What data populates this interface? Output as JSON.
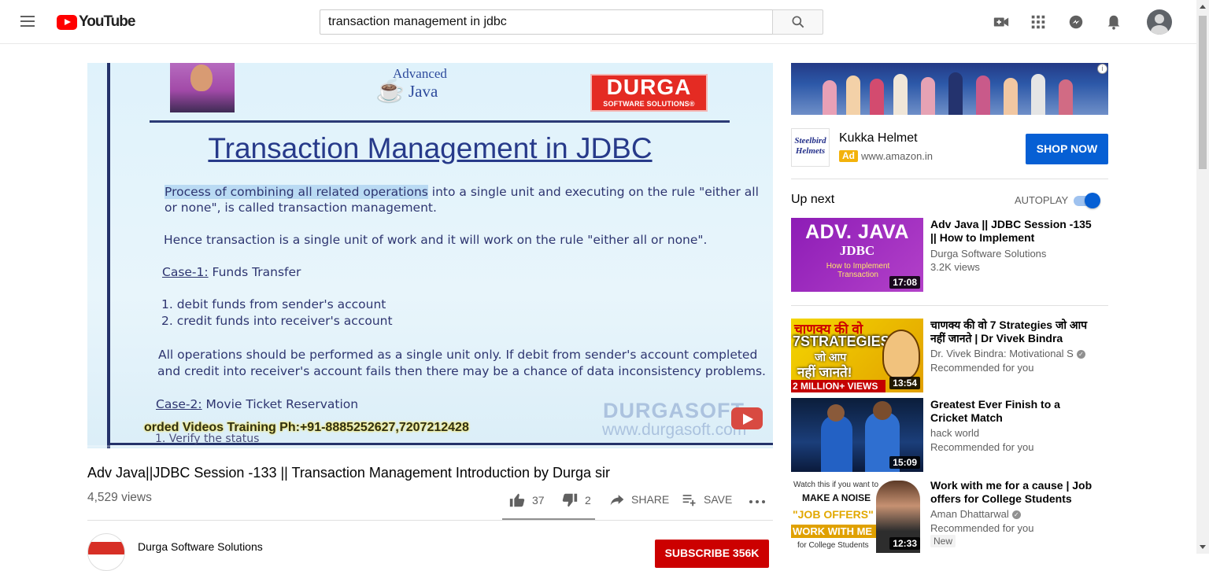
{
  "header": {
    "logo_text": "YouTube",
    "search_value": "transaction management in jdbc",
    "icons": [
      "menu-icon",
      "search-icon",
      "create-video-icon",
      "apps-icon",
      "messages-icon",
      "notifications-icon",
      "account-avatar"
    ]
  },
  "player": {
    "slide": {
      "logo_advanced": "Advanced",
      "logo_java": "Java",
      "brand_big": "DURGA",
      "brand_small": "SOFTWARE SOLUTIONS®",
      "title": "Transaction Management in JDBC",
      "line1_highlight": "Process of combining all related operations",
      "line1_rest": " into a single unit and executing on the rule \"either all",
      "line2": "or none\", is called transaction management.",
      "line3": "Hence transaction is a single unit of work and it will work on the rule \"either all or none\".",
      "case1_label": "Case-1:",
      "case1_text": " Funds Transfer",
      "item1": "1. debit funds from sender's account",
      "item2": "2. credit funds into receiver's account",
      "para1": "All operations should be performed as a single unit only. If debit from sender's account completed",
      "para2": "and credit into receiver's account fails then there may be a chance of data inconsistency problems.",
      "case2_label": "Case-2:",
      "case2_text": " Movie Ticket Reservation",
      "ticker": "orded Videos Training Ph:+91-8885252627,7207212428",
      "ticker_under": "1. Verify the status",
      "watermark1": "DURGASOFT",
      "watermark2": "www.durgasoft.com"
    }
  },
  "video": {
    "title": "Adv Java||JDBC Session -133 || Transaction Management Introduction by Durga sir",
    "views": "4,529 views",
    "likes": "37",
    "dislikes": "2",
    "share_label": "SHARE",
    "save_label": "SAVE",
    "channel_name": "Durga Software Solutions",
    "subscribe_label": "SUBSCRIBE  356K"
  },
  "ad": {
    "logo_text": "Steelbird Helmets",
    "title": "Kukka Helmet",
    "badge": "Ad",
    "domain": "www.amazon.in",
    "cta": "SHOP NOW"
  },
  "sidebar": {
    "up_next_label": "Up next",
    "autoplay_label": "AUTOPLAY",
    "autoplay_on": true,
    "videos": [
      {
        "title": "Adv Java || JDBC Session -135 || How to Implement Transactio...",
        "channel": "Durga Software Solutions",
        "meta": "3.2K views",
        "duration": "17:08",
        "thumb_text": [
          "ADV. JAVA",
          "JDBC",
          "How to Implement Transaction"
        ]
      },
      {
        "title": "चाणक्य की वो 7 Strategies जो आप नहीं जानते | Dr Vivek Bindra",
        "channel": "Dr. Vivek Bindra: Motivational S",
        "verified": true,
        "meta": "Recommended for you",
        "duration": "13:54",
        "thumb_text": [
          "चाणक्य की वो",
          "7STRATEGIES",
          "जो आप",
          "नहीं जानते!",
          "2 MILLION+ VIEWS"
        ]
      },
      {
        "title": "Greatest Ever Finish to a Cricket Match",
        "channel": "hack world",
        "meta": "Recommended for you",
        "duration": "15:09",
        "thumb_text": []
      },
      {
        "title": "Work with me for a cause | Job offers for College Students",
        "channel": "Aman Dhattarwal",
        "verified": true,
        "meta": "Recommended for you",
        "badge": "New",
        "duration": "12:33",
        "thumb_text": [
          "Watch this if you want to",
          "MAKE A NOISE",
          "\"JOB OFFERS\"",
          "WORK WITH ME",
          "for College Students"
        ]
      }
    ]
  },
  "colors": {
    "brand_red": "#ff0000",
    "subscribe_red": "#cc0000",
    "link_blue": "#065fd4",
    "ad_yellow": "#f3b20b"
  }
}
